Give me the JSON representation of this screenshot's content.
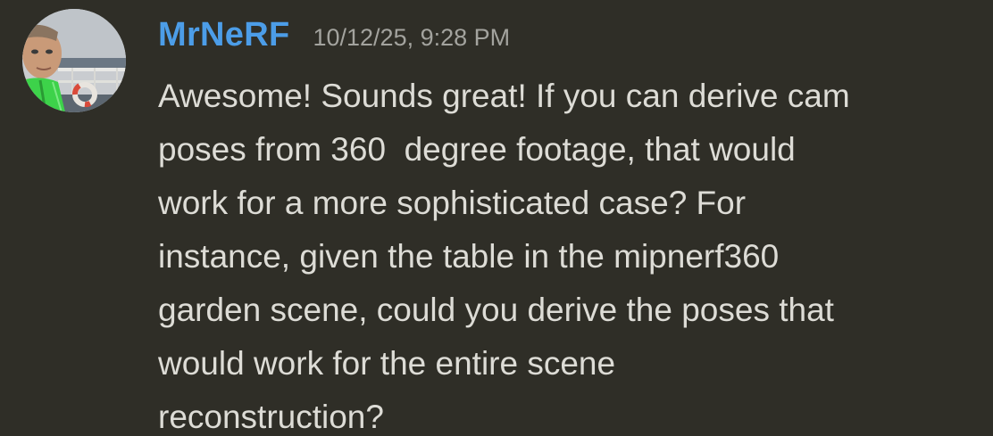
{
  "message": {
    "author": "MrNeRF",
    "timestamp": "10/12/25, 9:28 PM",
    "text": "Awesome! Sounds great! If you can derive cam\nposes from 360  degree footage, that would\nwork for a more sophisticated case? For\ninstance, given the table in the mipnerf360\ngarden scene, could you derive the poses that\nwould work for the entire scene\nreconstruction?"
  },
  "colors": {
    "background": "#2f2e27",
    "username": "#4c9de8",
    "timestamp": "#a3a39e",
    "text": "#dddcd6"
  },
  "icons": {
    "avatar": "user-avatar-photo"
  }
}
